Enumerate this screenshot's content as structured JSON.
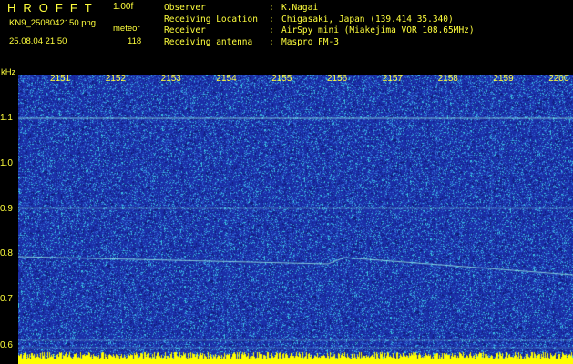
{
  "header": {
    "logo": "HROFFT",
    "version": "1.00f",
    "filename": "KN9_2508042150.png",
    "mode": "meteor",
    "timestamp": "25.08.04 21:50",
    "count": "118"
  },
  "info": [
    {
      "label": "Observer",
      "value": "K.Nagai"
    },
    {
      "label": "Receiving Location",
      "value": "Chigasaki, Japan (139.414 35.340)"
    },
    {
      "label": "Receiver",
      "value": "AirSpy mini (Miakejima VOR 108.65MHz)"
    },
    {
      "label": "Receiving antenna",
      "value": "Maspro FM-3"
    }
  ],
  "plot": {
    "y_unit": "kHz",
    "x_ticks": [
      "2151",
      "2152",
      "2153",
      "2154",
      "2155",
      "2156",
      "2157",
      "2158",
      "2159",
      "2200"
    ],
    "y_ticks": [
      "1.1",
      "1.0",
      "0.9",
      "0.8",
      "0.7",
      "0.6"
    ],
    "colors": {
      "background": "#1b2fa8",
      "noise_light": "#3a78d8",
      "noise_cyan": "#33d0e0",
      "trace": "#9ff5e8",
      "floor": "#ffff00"
    }
  }
}
